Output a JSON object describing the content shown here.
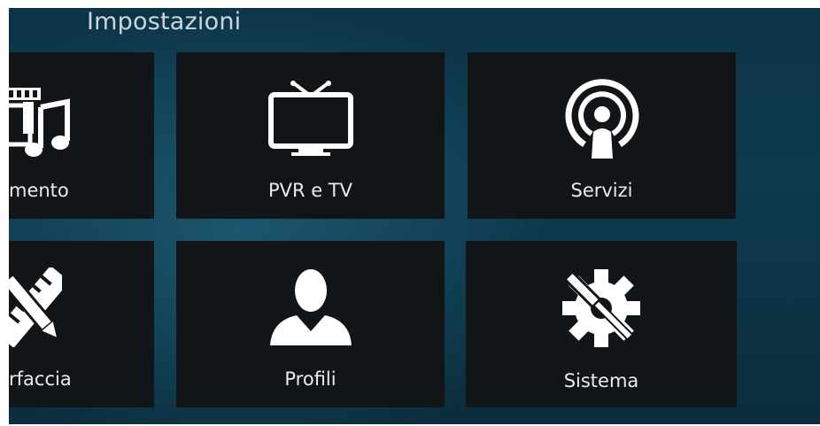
{
  "header": {
    "title": "Impostazioni"
  },
  "tiles": [
    {
      "label": "mento",
      "icon": "media-filmstrip-music-icon"
    },
    {
      "label": "PVR e TV",
      "icon": "tv-icon"
    },
    {
      "label": "Servizi",
      "icon": "broadcast-user-icon"
    },
    {
      "label": "rfaccia",
      "icon": "pencil-ruler-icon"
    },
    {
      "label": "Profili",
      "icon": "user-profile-icon"
    },
    {
      "label": "Sistema",
      "icon": "gear-screwdriver-icon"
    }
  ],
  "colors": {
    "background": "#0e3a4e",
    "tile": "#121518",
    "text": "#e8ecee",
    "title": "#cfd6da"
  }
}
